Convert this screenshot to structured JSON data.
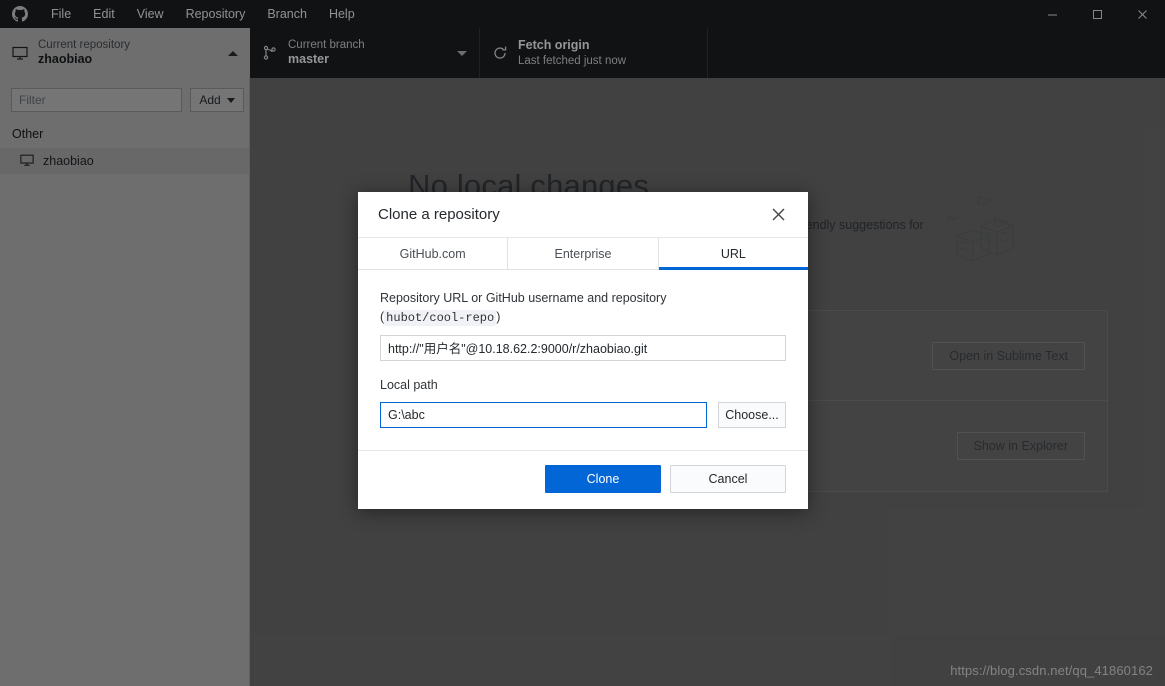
{
  "titlebar": {
    "logo_icon": "github-mark-icon",
    "menus": [
      "File",
      "Edit",
      "View",
      "Repository",
      "Branch",
      "Help"
    ],
    "window_controls": {
      "minimize": "minimize-icon",
      "maximize": "maximize-icon",
      "close": "close-icon"
    }
  },
  "toolbar": {
    "repository": {
      "icon": "desktop-icon",
      "label": "Current repository",
      "value": "zhaobiao"
    },
    "branch": {
      "icon": "branch-icon",
      "label": "Current branch",
      "value": "master"
    },
    "fetch": {
      "icon": "sync-icon",
      "label": "Fetch origin",
      "value": "Last fetched just now"
    }
  },
  "sidebar": {
    "filter_placeholder": "Filter",
    "filter_value": "",
    "add_label": "Add",
    "group_header": "Other",
    "repositories": [
      {
        "icon": "desktop-icon",
        "name": "zhaobiao"
      }
    ]
  },
  "main": {
    "title": "No local changes",
    "subtitle": "You have no uncommitted changes in your repository! Here are some friendly suggestions for",
    "suggestions": [
      {
        "button": "Open in Sublime Text"
      },
      {
        "button": "Show in Explorer"
      }
    ],
    "watermark": "https://blog.csdn.net/qq_41860162"
  },
  "modal": {
    "title": "Clone a repository",
    "close_icon": "close-icon",
    "tabs": [
      {
        "label": "GitHub.com",
        "active": false
      },
      {
        "label": "Enterprise",
        "active": false
      },
      {
        "label": "URL",
        "active": true
      }
    ],
    "url_field": {
      "label_line1": "Repository URL or GitHub username and repository",
      "label_paren_open": "(",
      "label_example": "hubot/cool-repo",
      "label_paren_close": ")",
      "value": "http://\"用户名\"@10.18.62.2:9000/r/zhaobiao.git",
      "placeholder": ""
    },
    "path_field": {
      "label": "Local path",
      "value": "G:\\abc",
      "placeholder": "",
      "choose_label": "Choose..."
    },
    "buttons": {
      "primary": "Clone",
      "secondary": "Cancel"
    }
  },
  "colors": {
    "accent": "#0366d6",
    "titlebar_bg": "#181a1d",
    "sidebar_bg": "#9e9e9e",
    "content_bg": "#5e5e5e",
    "modal_bg": "#ffffff"
  }
}
